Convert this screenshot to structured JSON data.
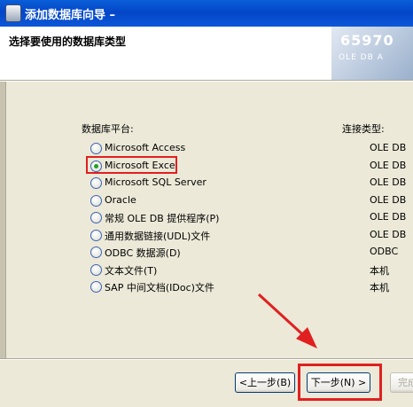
{
  "window": {
    "title": "添加数据库向导  –"
  },
  "header": {
    "title": "选择要使用的数据库类型",
    "logo_text": "65970",
    "logo_sub": "OLE DB  A"
  },
  "columns": {
    "platform": "数据库平台:",
    "connection": "连接类型:"
  },
  "options": [
    {
      "label": "Microsoft Access",
      "type": "OLE DB",
      "checked": false
    },
    {
      "label": "Microsoft Excel",
      "type": "OLE DB",
      "checked": true
    },
    {
      "label": "Microsoft SQL Server",
      "type": "OLE DB",
      "checked": false
    },
    {
      "label": "Oracle",
      "type": "OLE DB",
      "checked": false
    },
    {
      "label": "常规 OLE DB 提供程序(P)",
      "type": "OLE DB",
      "checked": false
    },
    {
      "label": "通用数据链接(UDL)文件",
      "type": "OLE DB",
      "checked": false
    },
    {
      "label": "ODBC 数据源(D)",
      "type": "ODBC",
      "checked": false
    },
    {
      "label": "文本文件(T)",
      "type": "本机",
      "checked": false
    },
    {
      "label": "SAP 中间文档(IDoc)文件",
      "type": "本机",
      "checked": false
    }
  ],
  "buttons": {
    "back": "<上一步(B)",
    "next": "下一步(N) >",
    "finish": "完成"
  },
  "colors": {
    "titlebar": "#0346c8",
    "highlight": "#e02020",
    "dialog": "#ece9d8"
  }
}
